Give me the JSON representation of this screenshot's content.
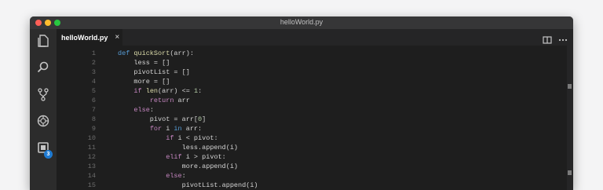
{
  "window": {
    "title": "helloWorld.py"
  },
  "tabs": [
    {
      "label": "helloWorld.py",
      "close": "×"
    }
  ],
  "activity": {
    "icons": [
      "files-icon",
      "search-icon",
      "source-control-icon",
      "debug-icon",
      "extensions-icon"
    ],
    "badge": "3"
  },
  "editor": {
    "line_numbers": [
      "1",
      "2",
      "3",
      "4",
      "5",
      "6",
      "7",
      "8",
      "9",
      "10",
      "11",
      "12",
      "13",
      "14",
      "15"
    ],
    "lines": [
      [
        {
          "t": "def ",
          "c": "kw"
        },
        {
          "t": "quickSort",
          "c": "fn"
        },
        {
          "t": "(arr):",
          "c": ""
        }
      ],
      [
        {
          "t": "    less = []",
          "c": ""
        }
      ],
      [
        {
          "t": "    pivotList = []",
          "c": ""
        }
      ],
      [
        {
          "t": "    more = []",
          "c": ""
        }
      ],
      [
        {
          "t": "    ",
          "c": ""
        },
        {
          "t": "if ",
          "c": "ctl"
        },
        {
          "t": "len",
          "c": "fn"
        },
        {
          "t": "(arr) <= ",
          "c": ""
        },
        {
          "t": "1",
          "c": "num"
        },
        {
          "t": ":",
          "c": ""
        }
      ],
      [
        {
          "t": "        ",
          "c": ""
        },
        {
          "t": "return ",
          "c": "ctl"
        },
        {
          "t": "arr",
          "c": ""
        }
      ],
      [
        {
          "t": "    ",
          "c": ""
        },
        {
          "t": "else",
          "c": "ctl"
        },
        {
          "t": ":",
          "c": ""
        }
      ],
      [
        {
          "t": "        pivot = arr[",
          "c": ""
        },
        {
          "t": "0",
          "c": "num"
        },
        {
          "t": "]",
          "c": ""
        }
      ],
      [
        {
          "t": "        ",
          "c": ""
        },
        {
          "t": "for ",
          "c": "ctl"
        },
        {
          "t": "i ",
          "c": ""
        },
        {
          "t": "in ",
          "c": "kw"
        },
        {
          "t": "arr:",
          "c": ""
        }
      ],
      [
        {
          "t": "            ",
          "c": ""
        },
        {
          "t": "if ",
          "c": "ctl"
        },
        {
          "t": "i < pivot:",
          "c": ""
        }
      ],
      [
        {
          "t": "                less.append(i)",
          "c": ""
        }
      ],
      [
        {
          "t": "            ",
          "c": ""
        },
        {
          "t": "elif ",
          "c": "ctl"
        },
        {
          "t": "i > pivot:",
          "c": ""
        }
      ],
      [
        {
          "t": "                more.append(i)",
          "c": ""
        }
      ],
      [
        {
          "t": "            ",
          "c": ""
        },
        {
          "t": "else",
          "c": "ctl"
        },
        {
          "t": ":",
          "c": ""
        }
      ],
      [
        {
          "t": "                pivotList.append(i)",
          "c": ""
        }
      ]
    ]
  },
  "colors": {
    "accent": "#1e7ad2",
    "keyword": "#569cd6",
    "control": "#c586c0",
    "function": "#dcdcaa",
    "number": "#b5cea8"
  }
}
